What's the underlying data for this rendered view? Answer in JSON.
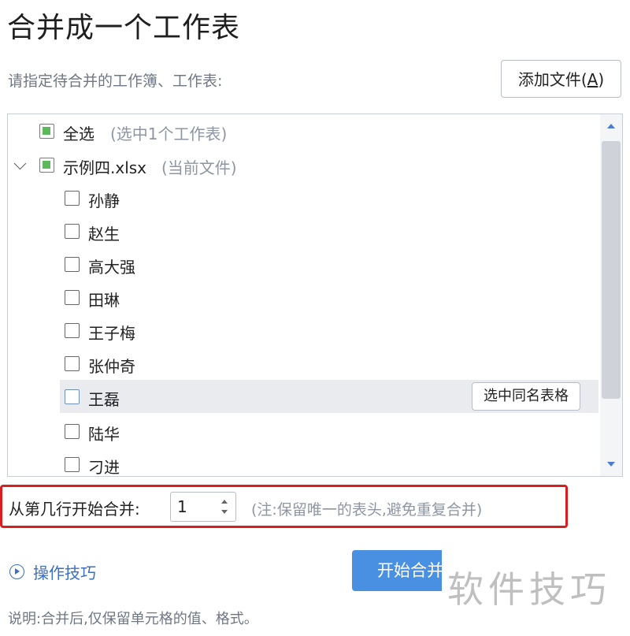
{
  "dialog": {
    "title": "合并成一个工作表",
    "subtitle": "请指定待合并的工作簿、工作表:",
    "add_file_label": "添加文件(",
    "add_file_key": "A",
    "add_file_end": ")"
  },
  "list": {
    "select_all": {
      "label": "全选",
      "note": "(选中1个工作表)",
      "state": "partial"
    },
    "file": {
      "label": "示例四.xlsx",
      "note": "(当前文件)",
      "state": "partial",
      "expanded": true
    },
    "sheets": [
      "孙静",
      "赵生",
      "高大强",
      "田琳",
      "王子梅",
      "张仲奇",
      "王磊",
      "陆华",
      "刁进"
    ],
    "hovered_sheet": "王磊",
    "select_same_name_label": "选中同名表格"
  },
  "start_row": {
    "label": "从第几行开始合并:",
    "value": "1",
    "hint": "(注:保留唯一的表头,避免重复合并)"
  },
  "footer": {
    "tips_label": "操作技巧",
    "merge_button_label": "开始合并",
    "note": "说明:合并后,仅保留单元格的值、格式。",
    "watermark": "软件技巧"
  },
  "colors": {
    "accent": "#4a90e2",
    "highlight_border": "#d81e1e",
    "checkbox_partial": "#5cb85c",
    "link": "#3a6fc4"
  }
}
